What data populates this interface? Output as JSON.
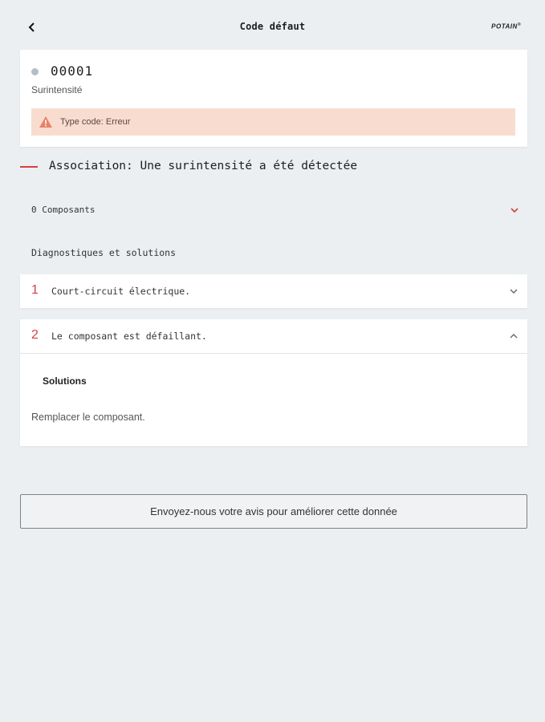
{
  "header": {
    "title": "Code défaut",
    "brand": "POTAIN",
    "brand_mark": "®"
  },
  "fault": {
    "code": "00001",
    "label": "Surintensité",
    "alert_text": "Type code: Erreur",
    "dot_color": "#b5bec6",
    "alert_color": "#f9dcd0"
  },
  "association": {
    "text": "Association: Une surintensité a été détectée",
    "accent_color": "#d64040"
  },
  "components": {
    "label": "0 Composants"
  },
  "diagnostics": {
    "section_title": "Diagnostiques et solutions",
    "items": [
      {
        "number": "1",
        "text": "Court-circuit électrique.",
        "expanded": false
      },
      {
        "number": "2",
        "text": "Le composant est défaillant.",
        "expanded": true
      }
    ],
    "solutions_title": "Solutions",
    "solutions_text": "Remplacer le composant."
  },
  "feedback": {
    "label": "Envoyez-nous votre avis pour améliorer cette donnée"
  },
  "icons": {
    "back": "chevron-left-icon",
    "warning": "warning-icon",
    "expand": "chevron-down-icon",
    "collapse": "chevron-up-icon"
  }
}
